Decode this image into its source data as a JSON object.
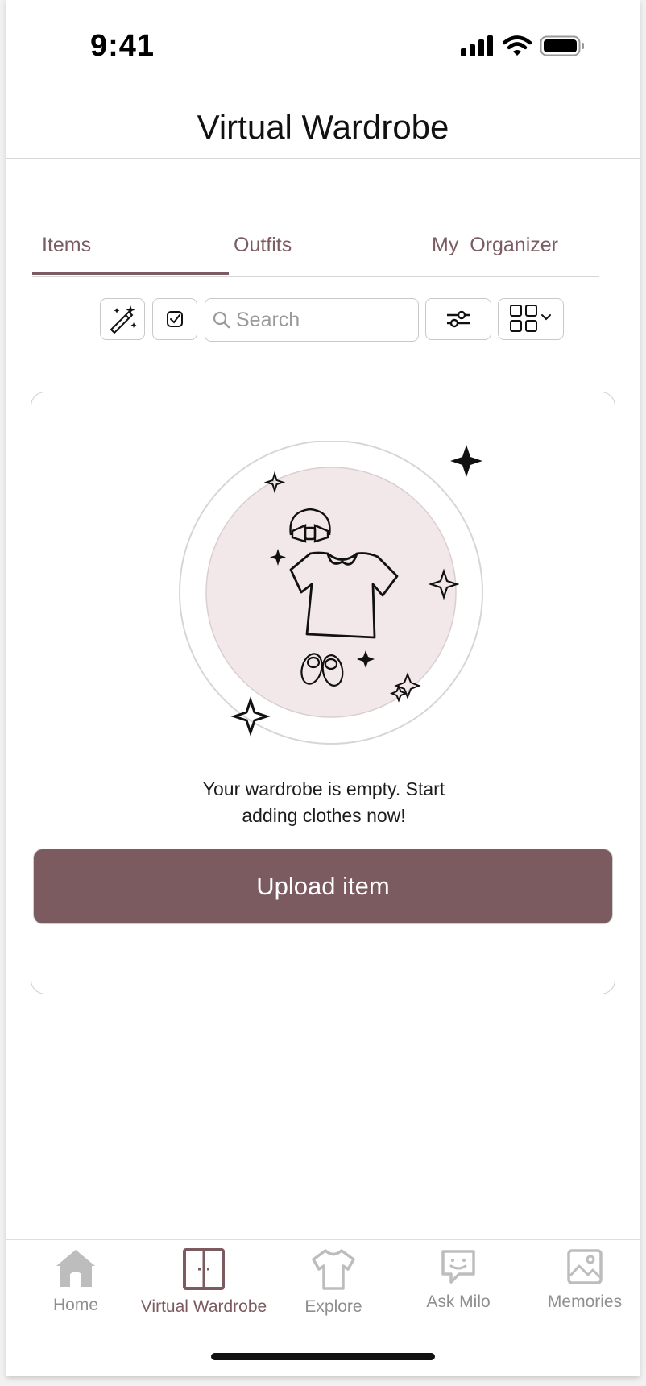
{
  "status_bar": {
    "time": "9:41"
  },
  "header": {
    "title": "Virtual Wardrobe"
  },
  "tabs": [
    {
      "label": "Items",
      "active": true
    },
    {
      "label": "Outfits",
      "active": false
    },
    {
      "label": "My  Organizer",
      "active": false
    }
  ],
  "toolbar": {
    "magic_icon": "magic-wand-icon",
    "select_icon": "checkbox-icon",
    "search_placeholder": "Search",
    "filter_icon": "sliders-icon",
    "view_icon": "grid-view-icon"
  },
  "empty_state": {
    "message_line1": "Your wardrobe is empty. Start",
    "message_line2": "adding clothes now!",
    "upload_label": "Upload item"
  },
  "bottom_nav": [
    {
      "label": "Home",
      "icon": "home-icon",
      "active": false
    },
    {
      "label": "Virtual Wardrobe",
      "icon": "wardrobe-icon",
      "active": true
    },
    {
      "label": "Explore",
      "icon": "tshirt-icon",
      "active": false
    },
    {
      "label": "Ask Milo",
      "icon": "chat-bot-icon",
      "active": false
    },
    {
      "label": "Memories",
      "icon": "image-icon",
      "active": false
    }
  ],
  "colors": {
    "accent": "#7b5a60",
    "illustration_bg": "#f2e8e9"
  }
}
